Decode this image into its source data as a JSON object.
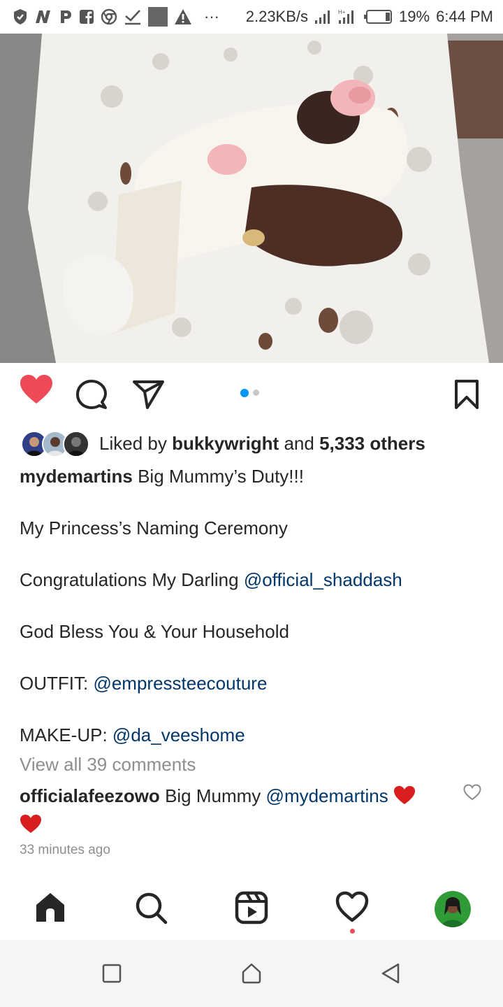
{
  "status_bar": {
    "left_icons": [
      "shield-icon",
      "n-app-icon",
      "p-app-icon",
      "facebook-icon",
      "chrome-icon",
      "check-download-icon",
      "gray-square-icon",
      "warning-icon"
    ],
    "overflow": "···",
    "speed": "2.23KB/s",
    "battery": "19%",
    "time": "6:44 PM"
  },
  "post": {
    "image_description_icon": "photo",
    "carousel": {
      "count": 2,
      "active": 1
    },
    "likes": {
      "prefix": "Liked by",
      "user": "bukkywright",
      "connector": "and",
      "others": "5,333 others"
    },
    "caption": {
      "username": "mydemartins",
      "line1": "Big Mummy’s Duty!!!",
      "line2": "My Princess’s Naming Ceremony",
      "line3_text": "Congratulations My Darling",
      "line3_mention": "@official_shaddash",
      "line4": "God Bless You & Your Household",
      "line5_label": "OUTFIT:",
      "line5_mention": "@empressteecouture",
      "line6_label": "MAKE-UP:",
      "line6_mention": "@da_veeshome"
    },
    "view_all": "View all 39 comments",
    "comment": {
      "username": "officialafeezowo",
      "text": "Big Mummy",
      "mention": "@mydemartins"
    },
    "time_ago": "33 minutes ago",
    "liked": true
  },
  "colors": {
    "like_red": "#ed4956",
    "link_blue": "#00376b",
    "carousel_active": "#0095f6"
  }
}
